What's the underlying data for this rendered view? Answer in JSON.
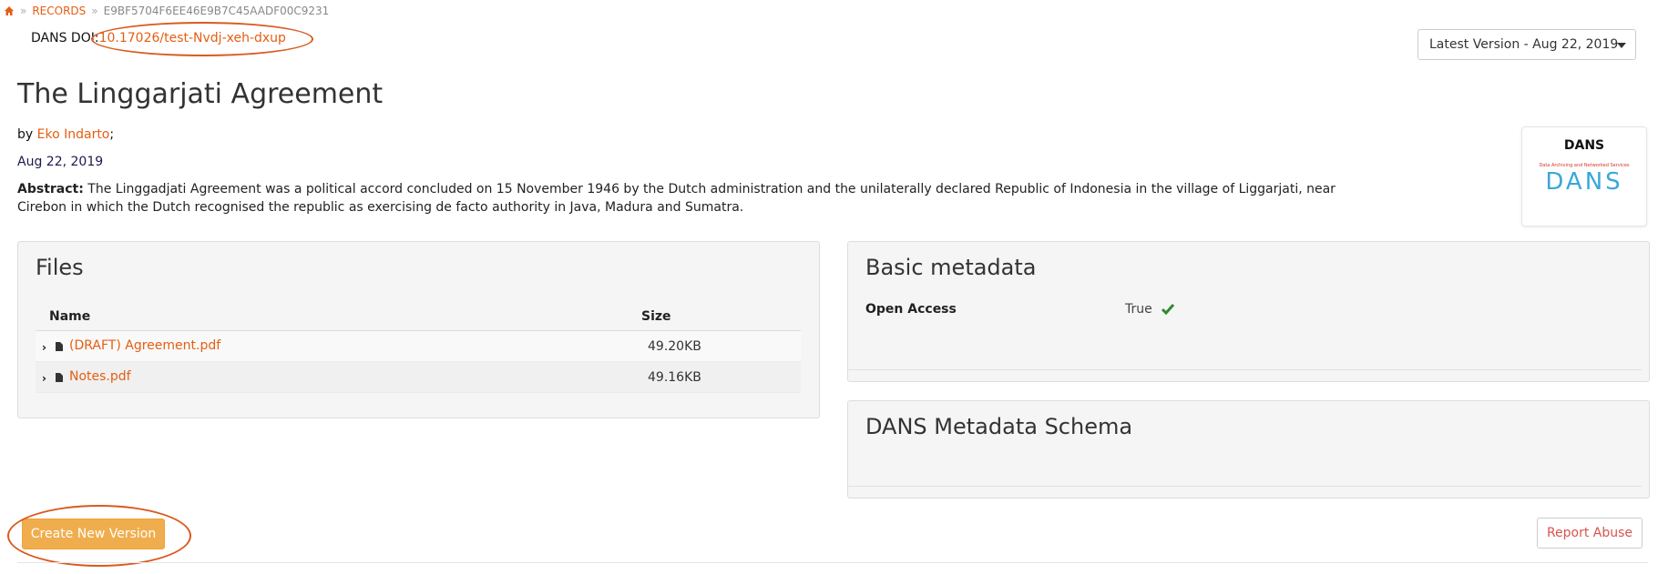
{
  "breadcrumb": {
    "home_icon": "home-icon",
    "records_label": "RECORDS",
    "separator": "»",
    "record_id": "E9BF5704F6EE46E9B7C45AADF00C9231"
  },
  "doi": {
    "label": "DANS DOI:",
    "value": "10.17026/test-Nvdj-xeh-dxup"
  },
  "version_select": {
    "selected": "Latest Version - Aug 22, 2019"
  },
  "record": {
    "title": "The Linggarjati Agreement",
    "by_label": "by",
    "author": "Eko Indarto",
    "author_suffix": ";",
    "date": "Aug 22, 2019",
    "abstract_label": "Abstract:",
    "abstract_text": "The Linggadjati Agreement was a political accord concluded on 15 November 1946 by the Dutch administration and the unilaterally declared Republic of Indonesia in the village of Liggarjati, near Cirebon in which the Dutch recognised the republic as exercising de facto authority in Java, Madura and Sumatra."
  },
  "community": {
    "name": "DANS",
    "logo_text": "DANS",
    "logo_tagline": "Data Archiving and Networked Services"
  },
  "files_panel": {
    "title": "Files",
    "columns": [
      "Name",
      "Size"
    ],
    "rows": [
      {
        "name": "(DRAFT) Agreement.pdf",
        "size": "49.20KB"
      },
      {
        "name": "Notes.pdf",
        "size": "49.16KB"
      }
    ]
  },
  "basic_metadata": {
    "title": "Basic metadata",
    "open_access_label": "Open Access",
    "open_access_value": "True"
  },
  "schema_panel": {
    "title": "DANS Metadata Schema"
  },
  "actions": {
    "create_new_version": "Create New Version",
    "report_abuse": "Report Abuse"
  },
  "colors": {
    "link": "#e55e12",
    "annotation": "#d85a1e",
    "warning_button": "#f0ad4e",
    "danger_text": "#d9534f",
    "check": "#2e8b2e",
    "logo_blue": "#3aa8d8",
    "logo_red": "#d9342b"
  }
}
